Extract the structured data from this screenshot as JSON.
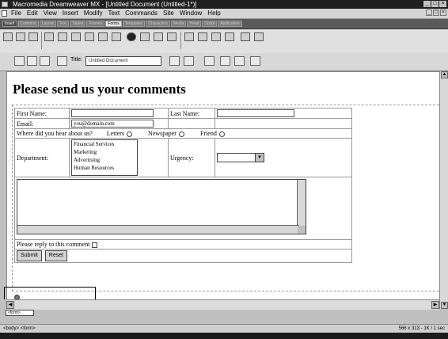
{
  "window": {
    "title": "Macromedia Dreamweaver MX - [Untitled Document (Untitled-1*)]",
    "controls": [
      "_",
      "□",
      "×"
    ]
  },
  "menu": {
    "items": [
      "File",
      "Edit",
      "View",
      "Insert",
      "Modify",
      "Text",
      "Commands",
      "Site",
      "Window",
      "Help"
    ],
    "doc_controls": [
      "_",
      "□",
      "×"
    ]
  },
  "insert_bar": {
    "tabs": [
      "Insert",
      "Common",
      "Layout",
      "Text",
      "Tables",
      "Frames",
      "Forms",
      "Templates",
      "Characters",
      "Media",
      "Head",
      "Script",
      "Application"
    ],
    "active_tab": "Forms"
  },
  "doc_toolbar": {
    "title_label": "Title:",
    "title_value": "Untitled Document"
  },
  "page": {
    "heading": "Please send us your comments"
  },
  "form": {
    "first_name_label": "First Name:",
    "last_name_label": "Last Name:",
    "email_label": "Email:",
    "email_value": "you@domain.com",
    "heard_label": "Where did you hear about us?",
    "heard_options": [
      "Letters",
      "Newspaper",
      "Friend"
    ],
    "department_label": "Department:",
    "department_options": [
      "Financial Services",
      "Marketing",
      "Advertising",
      "Human Resources"
    ],
    "urgency_label": "Urgency:",
    "reply_label": "Please reply to this comment",
    "submit_label": "Submit",
    "reset_label": "Reset"
  },
  "status": {
    "selected_tag": "<form>",
    "left": "<body> <form>",
    "right": "566 x 313 - 1K / 1 sec"
  }
}
